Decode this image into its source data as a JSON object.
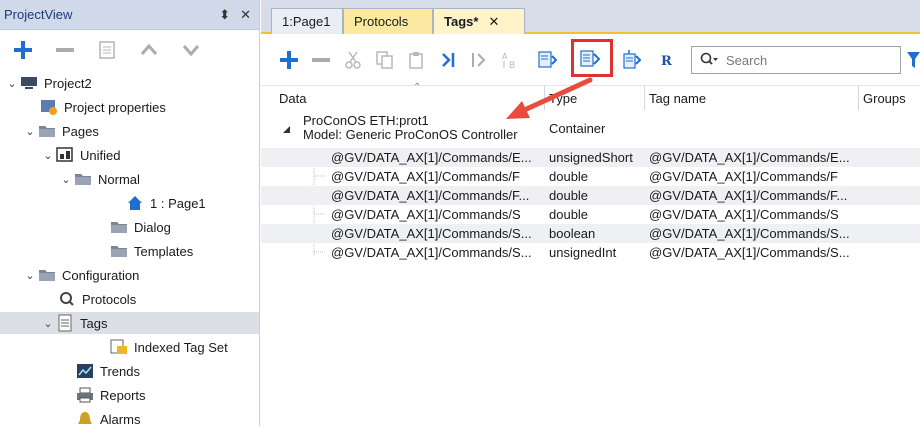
{
  "project_view": {
    "title": "ProjectView",
    "pin_glyph": "⬍",
    "close_glyph": "✕",
    "tree": [
      {
        "label": "Project2",
        "icon": "computer-icon"
      },
      {
        "label": "Project properties",
        "icon": "properties-icon"
      },
      {
        "label": "Pages",
        "icon": "folder-icon"
      },
      {
        "label": "Unified",
        "icon": "unified-icon"
      },
      {
        "label": "Normal",
        "icon": "folder-icon"
      },
      {
        "label": "1 : Page1",
        "icon": "home-icon"
      },
      {
        "label": "Dialog",
        "icon": "folder-icon"
      },
      {
        "label": "Templates",
        "icon": "folder-icon"
      },
      {
        "label": "Configuration",
        "icon": "folder-icon"
      },
      {
        "label": "Protocols",
        "icon": "protocols-icon"
      },
      {
        "label": "Tags",
        "icon": "tags-icon"
      },
      {
        "label": "Indexed Tag Set",
        "icon": "indexed-tags-icon"
      },
      {
        "label": "Trends",
        "icon": "trends-icon"
      },
      {
        "label": "Reports",
        "icon": "printer-icon"
      },
      {
        "label": "Alarms",
        "icon": "alarms-icon"
      }
    ]
  },
  "tabs": [
    {
      "label": "1:Page1"
    },
    {
      "label": "Protocols"
    },
    {
      "label": "Tags*"
    }
  ],
  "tab_close": "✕",
  "search": {
    "placeholder": "Search"
  },
  "grid": {
    "headers": [
      "Data",
      "Type",
      "Tag name",
      "Groups"
    ],
    "group": {
      "line1": "ProConOS ETH:prot1",
      "line2": "Model: Generic ProConOS Controller",
      "type": "Container"
    },
    "rows": [
      {
        "data": "@GV/DATA_AX[1]/Commands/E...",
        "type": "unsignedShort",
        "tag": "@GV/DATA_AX[1]/Commands/E..."
      },
      {
        "data": "@GV/DATA_AX[1]/Commands/F",
        "type": "double",
        "tag": "@GV/DATA_AX[1]/Commands/F"
      },
      {
        "data": "@GV/DATA_AX[1]/Commands/F...",
        "type": "double",
        "tag": "@GV/DATA_AX[1]/Commands/F..."
      },
      {
        "data": "@GV/DATA_AX[1]/Commands/S",
        "type": "double",
        "tag": "@GV/DATA_AX[1]/Commands/S"
      },
      {
        "data": "@GV/DATA_AX[1]/Commands/S...",
        "type": "boolean",
        "tag": "@GV/DATA_AX[1]/Commands/S..."
      },
      {
        "data": "@GV/DATA_AX[1]/Commands/S...",
        "type": "unsignedInt",
        "tag": "@GV/DATA_AX[1]/Commands/S..."
      }
    ]
  },
  "colors": {
    "accent_blue": "#1f6fd1",
    "highlight_red": "#e03131",
    "arrow_red": "#e74c3c",
    "tab_gold": "#f2c12e"
  }
}
